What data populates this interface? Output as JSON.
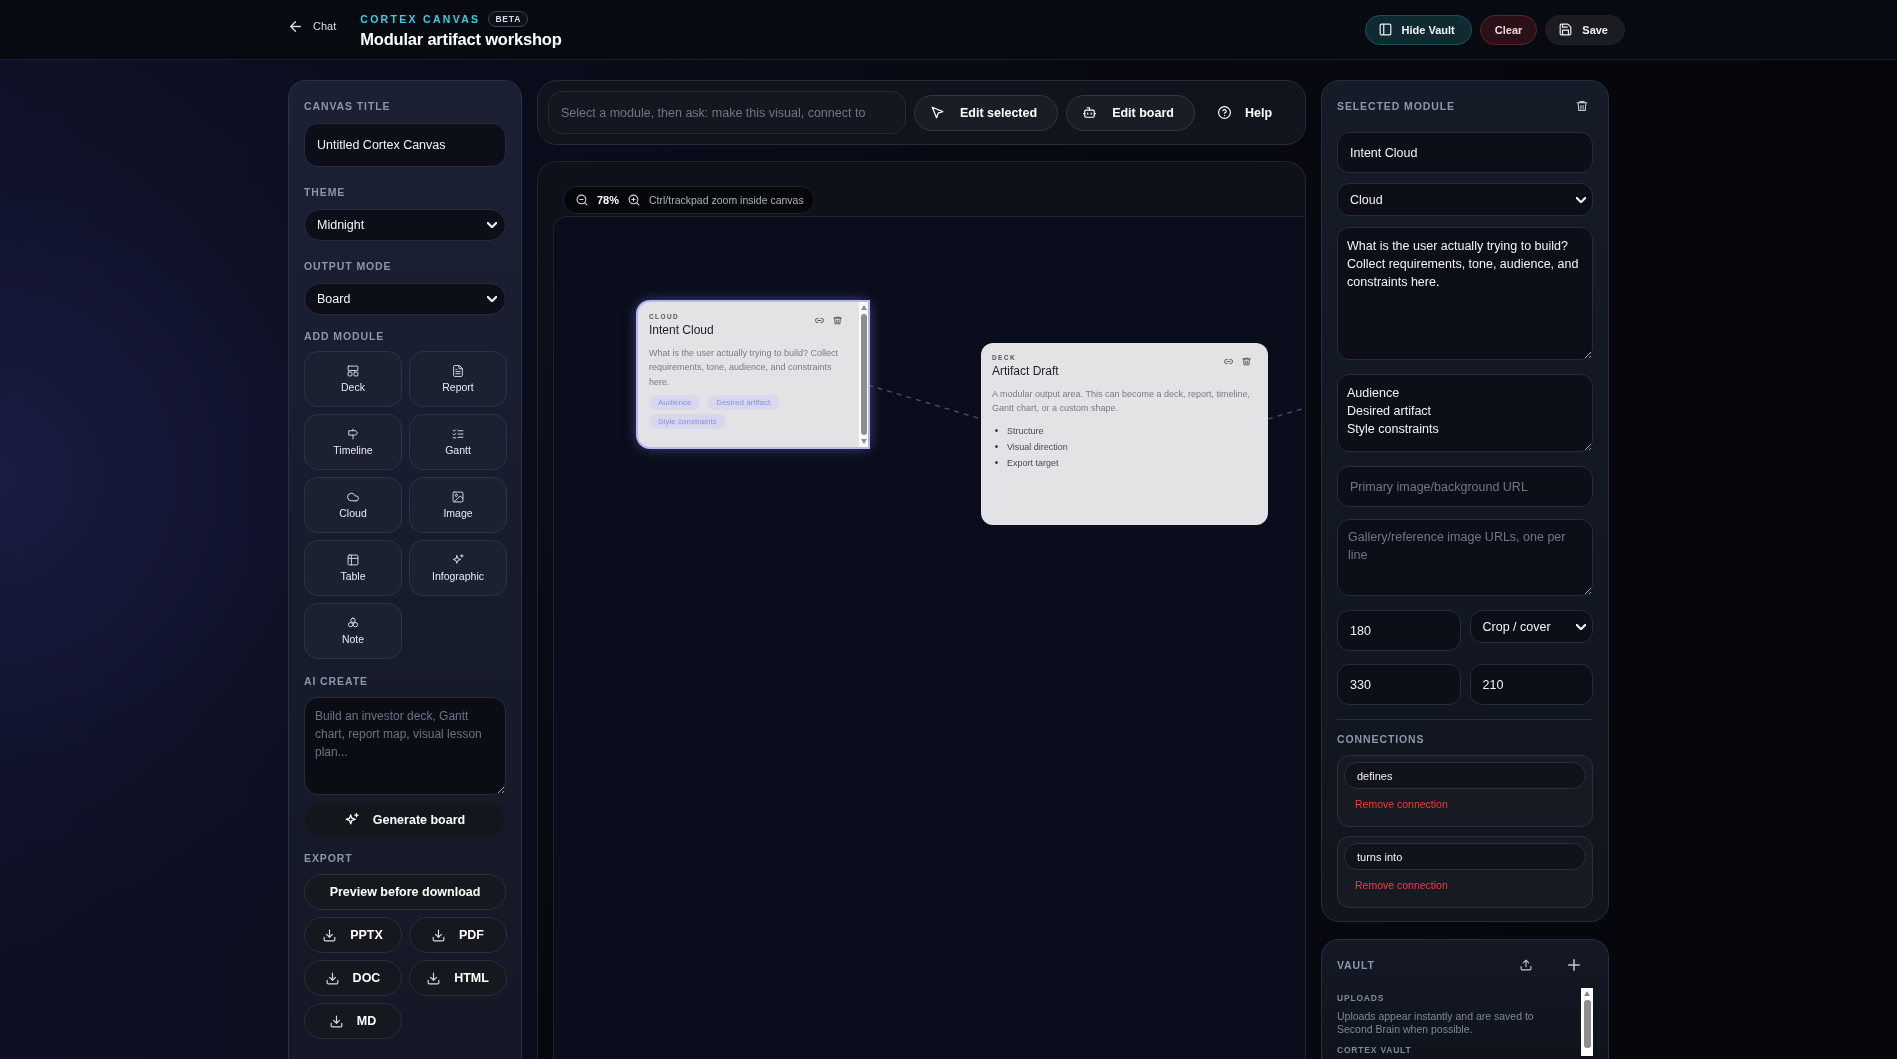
{
  "header": {
    "back_label": "Chat",
    "brand": "CORTEX CANVAS",
    "badge": "BETA",
    "title": "Modular artifact workshop",
    "actions": [
      {
        "label": "Hide Vault",
        "kind": "vault"
      },
      {
        "label": "Clear",
        "kind": "danger"
      },
      {
        "label": "Save",
        "kind": "save"
      }
    ]
  },
  "left_panel": {
    "canvas_title": {
      "label": "CANVAS TITLE",
      "value": "Untitled Cortex Canvas"
    },
    "theme": {
      "label": "THEME",
      "value": "Midnight"
    },
    "output_mode": {
      "label": "OUTPUT MODE",
      "value": "Board"
    },
    "add_module": {
      "label": "ADD MODULE",
      "modules": [
        {
          "label": "Deck",
          "kind": "deck"
        },
        {
          "label": "Report",
          "kind": "report"
        },
        {
          "label": "Timeline",
          "kind": "timeline"
        },
        {
          "label": "Gantt",
          "kind": "gantt"
        },
        {
          "label": "Cloud",
          "kind": "cloud"
        },
        {
          "label": "Image",
          "kind": "image"
        },
        {
          "label": "Table",
          "kind": "table"
        },
        {
          "label": "Infographic",
          "kind": "infographic"
        },
        {
          "label": "Note",
          "kind": "note"
        }
      ]
    },
    "ai_create": {
      "label": "AI CREATE",
      "placeholder": "Build an investor deck, Gantt chart, report map, visual lesson plan...",
      "button": "Generate board"
    },
    "export": {
      "label": "EXPORT",
      "preview_button": "Preview before download",
      "formats": [
        "PPTX",
        "PDF",
        "DOC",
        "HTML",
        "MD"
      ]
    }
  },
  "toolbar": {
    "prompt": {
      "placeholder": "Select a module, then ask: make this visual, connect to"
    },
    "buttons": [
      {
        "label": "Edit selected",
        "kind": "cursor"
      },
      {
        "label": "Edit board",
        "kind": "robot"
      },
      {
        "label": "Help",
        "kind": "help"
      }
    ]
  },
  "canvas": {
    "zoom": "78%",
    "zoom_hint": "Ctrl/trackpad zoom inside canvas",
    "nodes": [
      {
        "type_label": "CLOUD",
        "title": "Intent Cloud",
        "body": "What is the user actually trying to build? Collect requirements, tone, audience, and constraints here.",
        "tags": [
          "Audience",
          "Desired artifact",
          "Style constraints"
        ],
        "selected": true,
        "scrollable": true
      },
      {
        "type_label": "DECK",
        "title": "Artifact Draft",
        "body": "A modular output area. This can become a deck, report, timeline, Gantt chart, or a custom shape.",
        "bullets": [
          "Structure",
          "Visual direction",
          "Export target"
        ],
        "selected": false,
        "scrollable": false
      }
    ]
  },
  "selected_module": {
    "label": "SELECTED MODULE",
    "name": "Intent Cloud",
    "type": "Cloud",
    "description": "What is the user actually trying to build? Collect requirements, tone, audience, and constraints here.",
    "tags_text": "Audience\nDesired artifact\nStyle constraints",
    "image_url": {
      "placeholder": "Primary image/background URL"
    },
    "gallery": {
      "placeholder": "Gallery/reference image URLs, one per line"
    },
    "field_row_1": {
      "input": "180",
      "select": "Crop / cover"
    },
    "field_row_2": [
      "330",
      "210"
    ],
    "connections": {
      "label": "CONNECTIONS",
      "items": [
        {
          "value": "defines",
          "remove_label": "Remove connection"
        },
        {
          "value": "turns into",
          "remove_label": "Remove connection"
        }
      ]
    }
  },
  "vault": {
    "label": "VAULT",
    "uploads_label": "UPLOADS",
    "uploads_text": "Uploads appear instantly and are saved to Second Brain when possible.",
    "section_label": "CORTEX VAULT"
  }
}
